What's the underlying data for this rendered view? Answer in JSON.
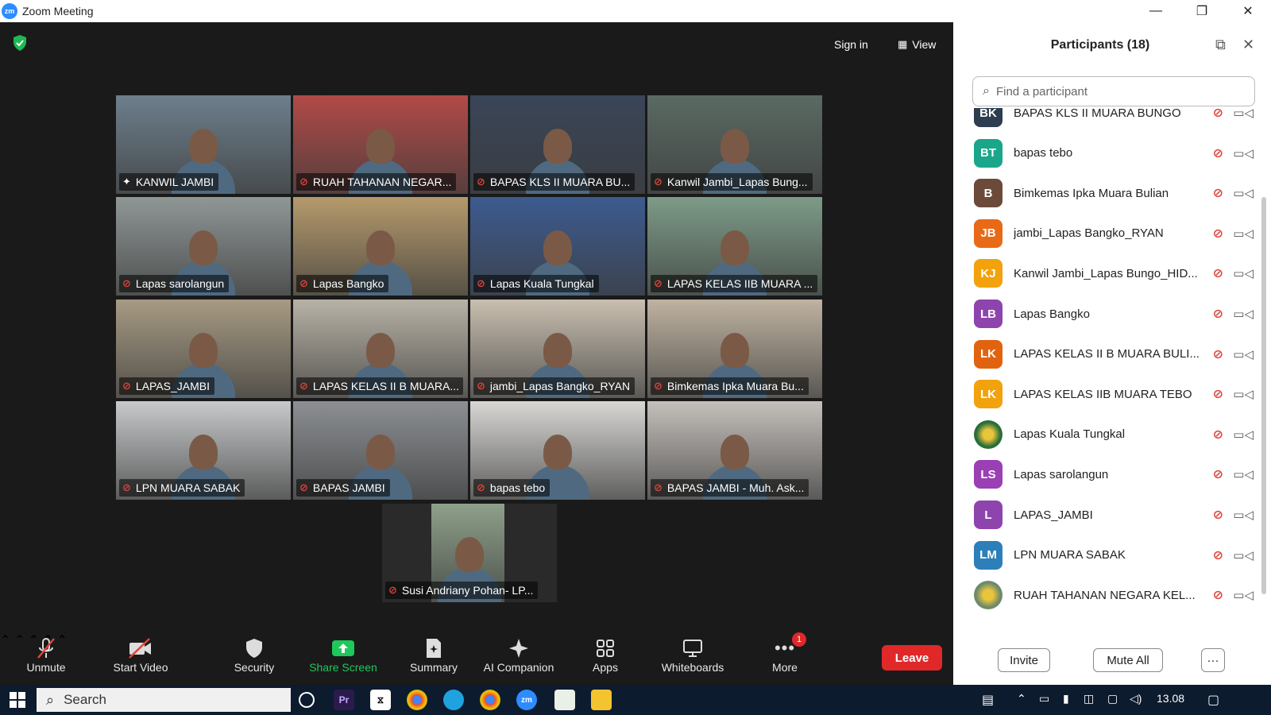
{
  "window": {
    "app_logo": "zm",
    "title": "Zoom Meeting",
    "minimize": "—",
    "restore": "❐",
    "close": "✕"
  },
  "header": {
    "sign_in": "Sign in",
    "view": "View"
  },
  "tiles": [
    {
      "name": "KANWIL JAMBI",
      "active": true,
      "bg": "#6d7f8c"
    },
    {
      "name": "RUAH TAHANAN NEGAR...",
      "bg": "#b14a47"
    },
    {
      "name": "BAPAS KLS II  MUARA BU...",
      "bg": "#3a4558"
    },
    {
      "name": "Kanwil Jambi_Lapas Bung...",
      "bg": "#5a6a63"
    },
    {
      "name": "Lapas sarolangun",
      "bg": "#8f9796"
    },
    {
      "name": "Lapas Bangko",
      "bg": "#b59a6c"
    },
    {
      "name": "Lapas Kuala Tungkal",
      "bg": "#3c5b8f"
    },
    {
      "name": "LAPAS KELAS IIB MUARA ...",
      "bg": "#7d9b88"
    },
    {
      "name": "LAPAS_JAMBI",
      "bg": "#a79a83"
    },
    {
      "name": "LAPAS KELAS II B MUARA...",
      "bg": "#b8b2a6"
    },
    {
      "name": "jambi_Lapas Bangko_RYAN",
      "bg": "#c9bfb0"
    },
    {
      "name": "Bimkemas Ipka Muara Bu...",
      "bg": "#bfb3a1"
    },
    {
      "name": "LPN MUARA SABAK",
      "bg": "#c7c9ca"
    },
    {
      "name": "BAPAS JAMBI",
      "bg": "#8c8f93"
    },
    {
      "name": "bapas tebo",
      "bg": "#d8d7d4"
    },
    {
      "name": "BAPAS JAMBI - Muh. Ask...",
      "bg": "#c5c0bb"
    },
    {
      "name": "Susi Andriany Pohan- LP...",
      "bg": "#8ea08a"
    }
  ],
  "toolbar": {
    "unmute": "Unmute",
    "start_video": "Start Video",
    "security": "Security",
    "share_screen": "Share Screen",
    "summary": "Summary",
    "ai_companion": "AI Companion",
    "apps": "Apps",
    "whiteboards": "Whiteboards",
    "more": "More",
    "more_badge": "1",
    "leave": "Leave"
  },
  "participants": {
    "title": "Participants (18)",
    "search_placeholder": "Find a participant",
    "invite": "Invite",
    "mute_all": "Mute All",
    "more_label": "···",
    "list": [
      {
        "initials": "BK",
        "name": "BAPAS KLS II  MUARA BUNGO",
        "color": "#2c3e50"
      },
      {
        "initials": "BT",
        "name": "bapas tebo",
        "color": "#1aa68a"
      },
      {
        "initials": "B",
        "name": "Bimkemas Ipka Muara Bulian",
        "color": "#6b4a3a"
      },
      {
        "initials": "JB",
        "name": "jambi_Lapas Bangko_RYAN",
        "color": "#e86a17"
      },
      {
        "initials": "KJ",
        "name": "Kanwil Jambi_Lapas Bungo_HID...",
        "color": "#f2a20c"
      },
      {
        "initials": "LB",
        "name": "Lapas Bangko",
        "color": "#8e44ad"
      },
      {
        "initials": "LK",
        "name": "LAPAS KELAS II B MUARA BULI...",
        "color": "#e2630f"
      },
      {
        "initials": "LK",
        "name": "LAPAS KELAS IIB MUARA TEBO",
        "color": "#f2a20c"
      },
      {
        "initials": "",
        "name": "Lapas Kuala Tungkal",
        "color": "#2a6e3a"
      },
      {
        "initials": "LS",
        "name": "Lapas sarolangun",
        "color": "#9b3fb5"
      },
      {
        "initials": "L",
        "name": "LAPAS_JAMBI",
        "color": "#8e44ad"
      },
      {
        "initials": "LM",
        "name": "LPN MUARA SABAK",
        "color": "#2c7fb8"
      },
      {
        "initials": "",
        "name": "RUAH TAHANAN NEGARA KEL...",
        "color": "#6f8a6a"
      }
    ]
  },
  "taskbar": {
    "search": "Search",
    "time": "13.08"
  }
}
